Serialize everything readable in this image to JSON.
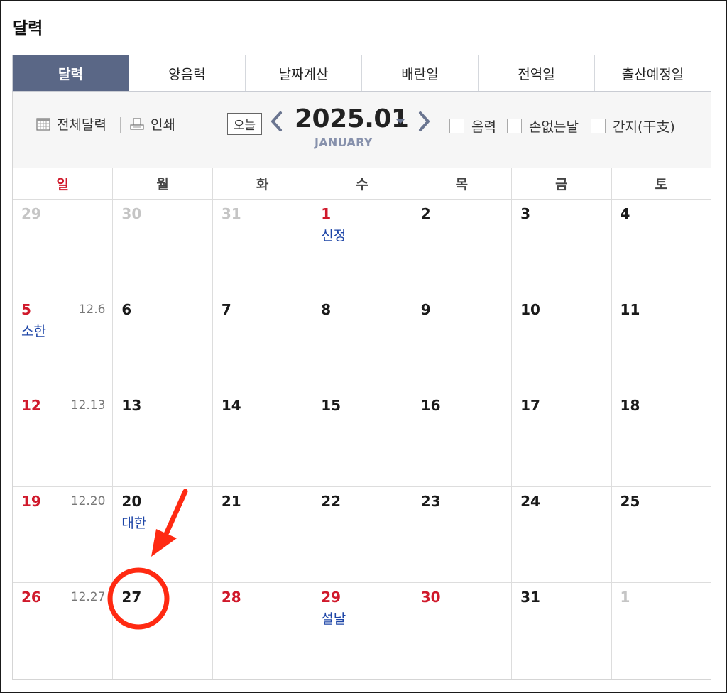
{
  "page_title": "달력",
  "tabs": [
    {
      "label": "달력",
      "active": true
    },
    {
      "label": "양음력",
      "active": false
    },
    {
      "label": "날짜계산",
      "active": false
    },
    {
      "label": "배란일",
      "active": false
    },
    {
      "label": "전역일",
      "active": false
    },
    {
      "label": "출산예정일",
      "active": false
    }
  ],
  "toolbar": {
    "full_calendar": "전체달력",
    "print": "인쇄",
    "today": "오늘",
    "year_month": "2025.01",
    "month_en": "JANUARY",
    "checks": [
      "음력",
      "손없는날",
      "간지(干支)"
    ]
  },
  "weekdays": [
    "일",
    "월",
    "화",
    "수",
    "목",
    "금",
    "토"
  ],
  "weeks": [
    [
      {
        "num": "29",
        "style": "gray",
        "lunar": "",
        "holiday": ""
      },
      {
        "num": "30",
        "style": "gray",
        "lunar": "",
        "holiday": ""
      },
      {
        "num": "31",
        "style": "gray",
        "lunar": "",
        "holiday": ""
      },
      {
        "num": "1",
        "style": "red",
        "lunar": "",
        "holiday": "신정"
      },
      {
        "num": "2",
        "style": "normal",
        "lunar": "",
        "holiday": ""
      },
      {
        "num": "3",
        "style": "normal",
        "lunar": "",
        "holiday": ""
      },
      {
        "num": "4",
        "style": "normal",
        "lunar": "",
        "holiday": ""
      }
    ],
    [
      {
        "num": "5",
        "style": "red",
        "lunar": "12.6",
        "holiday": "소한"
      },
      {
        "num": "6",
        "style": "normal",
        "lunar": "",
        "holiday": ""
      },
      {
        "num": "7",
        "style": "normal",
        "lunar": "",
        "holiday": ""
      },
      {
        "num": "8",
        "style": "normal",
        "lunar": "",
        "holiday": ""
      },
      {
        "num": "9",
        "style": "normal",
        "lunar": "",
        "holiday": ""
      },
      {
        "num": "10",
        "style": "normal",
        "lunar": "",
        "holiday": ""
      },
      {
        "num": "11",
        "style": "normal",
        "lunar": "",
        "holiday": ""
      }
    ],
    [
      {
        "num": "12",
        "style": "red",
        "lunar": "12.13",
        "holiday": ""
      },
      {
        "num": "13",
        "style": "normal",
        "lunar": "",
        "holiday": ""
      },
      {
        "num": "14",
        "style": "normal",
        "lunar": "",
        "holiday": ""
      },
      {
        "num": "15",
        "style": "normal",
        "lunar": "",
        "holiday": ""
      },
      {
        "num": "16",
        "style": "normal",
        "lunar": "",
        "holiday": ""
      },
      {
        "num": "17",
        "style": "normal",
        "lunar": "",
        "holiday": ""
      },
      {
        "num": "18",
        "style": "normal",
        "lunar": "",
        "holiday": ""
      }
    ],
    [
      {
        "num": "19",
        "style": "red",
        "lunar": "12.20",
        "holiday": ""
      },
      {
        "num": "20",
        "style": "normal",
        "lunar": "",
        "holiday": "대한"
      },
      {
        "num": "21",
        "style": "normal",
        "lunar": "",
        "holiday": ""
      },
      {
        "num": "22",
        "style": "normal",
        "lunar": "",
        "holiday": ""
      },
      {
        "num": "23",
        "style": "normal",
        "lunar": "",
        "holiday": ""
      },
      {
        "num": "24",
        "style": "normal",
        "lunar": "",
        "holiday": ""
      },
      {
        "num": "25",
        "style": "normal",
        "lunar": "",
        "holiday": ""
      }
    ],
    [
      {
        "num": "26",
        "style": "red",
        "lunar": "12.27",
        "holiday": ""
      },
      {
        "num": "27",
        "style": "normal",
        "lunar": "",
        "holiday": ""
      },
      {
        "num": "28",
        "style": "red",
        "lunar": "",
        "holiday": ""
      },
      {
        "num": "29",
        "style": "red",
        "lunar": "",
        "holiday": "설날"
      },
      {
        "num": "30",
        "style": "red",
        "lunar": "",
        "holiday": ""
      },
      {
        "num": "31",
        "style": "normal",
        "lunar": "",
        "holiday": ""
      },
      {
        "num": "1",
        "style": "gray",
        "lunar": "",
        "holiday": ""
      }
    ]
  ],
  "colors": {
    "tab_active": "#5a6786",
    "holiday_red": "#d0192b",
    "holiday_name_blue": "#1d45a7",
    "annotation_red": "#ff2a12"
  }
}
